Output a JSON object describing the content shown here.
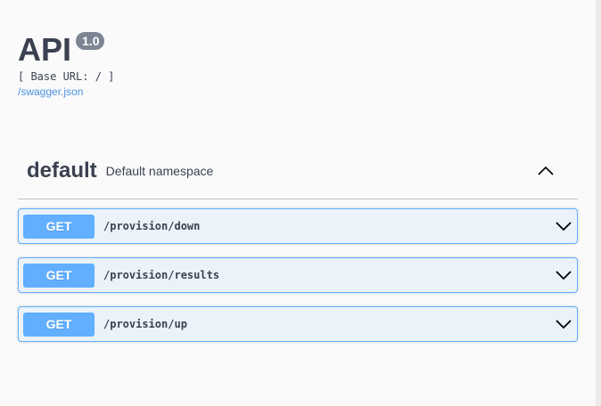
{
  "info": {
    "title": "API",
    "version": "1.0",
    "base_url": "[ Base URL: / ]",
    "spec_link": "/swagger.json"
  },
  "tag": {
    "name": "default",
    "description": "Default namespace",
    "expanded": true
  },
  "operations": [
    {
      "method": "GET",
      "path": "/provision/down"
    },
    {
      "method": "GET",
      "path": "/provision/results"
    },
    {
      "method": "GET",
      "path": "/provision/up"
    }
  ],
  "colors": {
    "get_method": "#61affe",
    "text": "#3b4151",
    "link": "#4990e2",
    "version_badge": "#7d8492",
    "background": "#fafafa"
  }
}
